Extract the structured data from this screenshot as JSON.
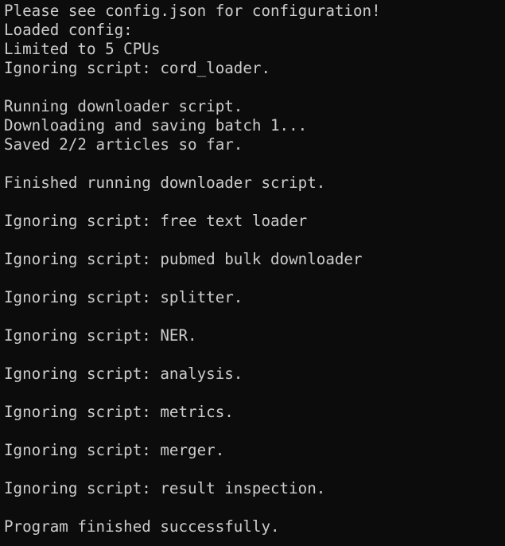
{
  "terminal": {
    "colors": {
      "background": "#0c0c0c",
      "foreground": "#cccccc"
    },
    "lines": [
      "Please see config.json for configuration!",
      "Loaded config:",
      "Limited to 5 CPUs",
      "Ignoring script: cord_loader.",
      "",
      "Running downloader script.",
      "Downloading and saving batch 1...",
      "Saved 2/2 articles so far.",
      "",
      "Finished running downloader script.",
      "",
      "Ignoring script: free text loader",
      "",
      "Ignoring script: pubmed bulk downloader",
      "",
      "Ignoring script: splitter.",
      "",
      "Ignoring script: NER.",
      "",
      "Ignoring script: analysis.",
      "",
      "Ignoring script: metrics.",
      "",
      "Ignoring script: merger.",
      "",
      "Ignoring script: result inspection.",
      "",
      "Program finished successfully."
    ]
  }
}
